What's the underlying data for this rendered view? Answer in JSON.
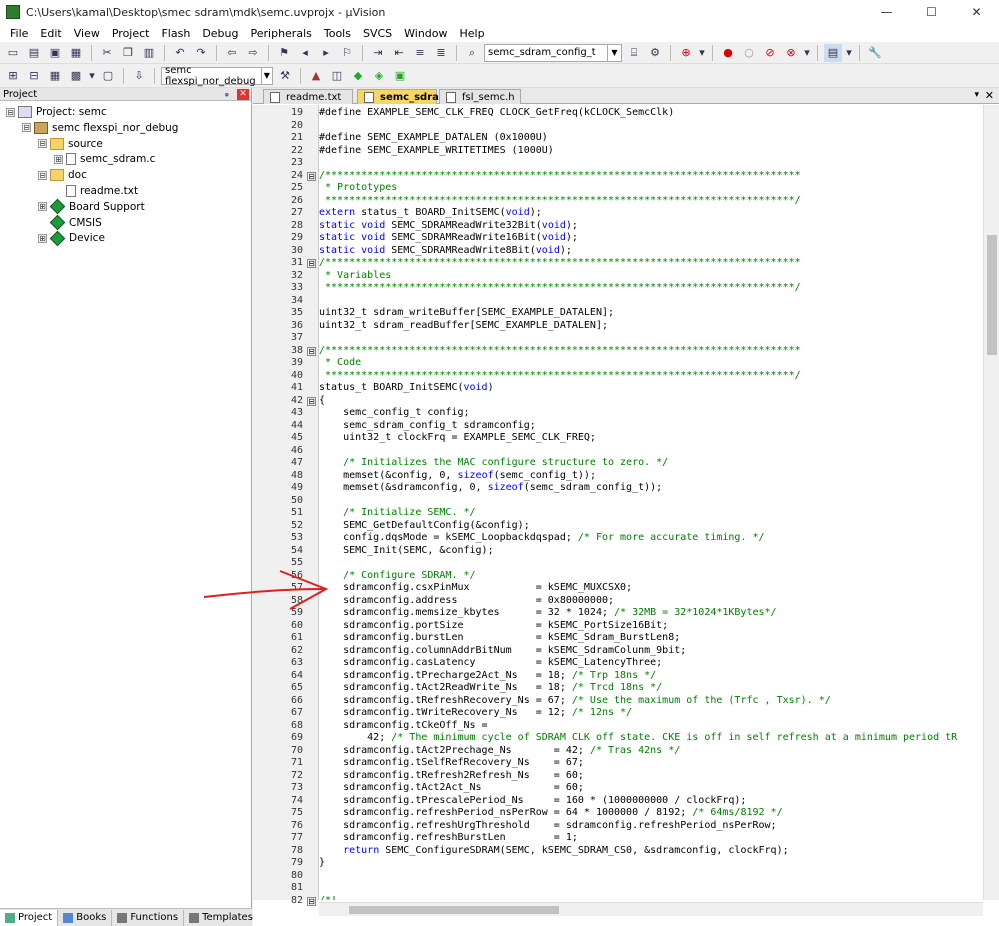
{
  "window": {
    "title": "C:\\Users\\kamal\\Desktop\\smec sdram\\mdk\\semc.uvprojx - µVision",
    "minimize": "—",
    "maximize": "☐",
    "close": "✕"
  },
  "menu": [
    "File",
    "Edit",
    "View",
    "Project",
    "Flash",
    "Debug",
    "Peripherals",
    "Tools",
    "SVCS",
    "Window",
    "Help"
  ],
  "toolbar": {
    "find_combo": "semc_sdram_config_t",
    "target_combo": "semc flexspi_nor_debug"
  },
  "project_panel": {
    "title": "Project",
    "pin": "ᵩ",
    "close": "✕",
    "tree": [
      {
        "level": 0,
        "exp": "⊟",
        "icon": "proj",
        "label": "Project: semc"
      },
      {
        "level": 1,
        "exp": "⊟",
        "icon": "target",
        "label": "semc flexspi_nor_debug"
      },
      {
        "level": 2,
        "exp": "⊟",
        "icon": "folder",
        "label": "source"
      },
      {
        "level": 3,
        "exp": "⊞",
        "icon": "file",
        "label": "semc_sdram.c"
      },
      {
        "level": 2,
        "exp": "⊟",
        "icon": "folder",
        "label": "doc"
      },
      {
        "level": 3,
        "exp": "",
        "icon": "file",
        "label": "readme.txt"
      },
      {
        "level": 2,
        "exp": "⊞",
        "icon": "gem",
        "label": "Board Support"
      },
      {
        "level": 2,
        "exp": "",
        "icon": "gem",
        "label": "CMSIS"
      },
      {
        "level": 2,
        "exp": "⊞",
        "icon": "gem",
        "label": "Device"
      }
    ],
    "bottom_tabs": [
      "Project",
      "Books",
      "Functions",
      "Templates"
    ]
  },
  "editor": {
    "tabs": [
      {
        "label": "readme.txt",
        "active": false
      },
      {
        "label": "semc_sdram.c",
        "active": true
      },
      {
        "label": "fsl_semc.h",
        "active": false
      }
    ],
    "tab_dropdown": "▾",
    "tab_close": "✕",
    "lines": [
      {
        "n": "19",
        "fold": "",
        "text": "#define EXAMPLE_SEMC_CLK_FREQ CLOCK_GetFreq(kCLOCK_SemcClk)"
      },
      {
        "n": "20",
        "fold": "",
        "text": ""
      },
      {
        "n": "21",
        "fold": "",
        "text": "#define SEMC_EXAMPLE_DATALEN (0x1000U)"
      },
      {
        "n": "22",
        "fold": "",
        "text": "#define SEMC_EXAMPLE_WRITETIMES (1000U)"
      },
      {
        "n": "23",
        "fold": "",
        "text": ""
      },
      {
        "n": "24",
        "fold": "⊟",
        "text": "/*******************************************************************************"
      },
      {
        "n": "25",
        "fold": "",
        "text": " * Prototypes"
      },
      {
        "n": "26",
        "fold": "",
        "text": " ******************************************************************************/"
      },
      {
        "n": "27",
        "fold": "",
        "text": "extern status_t BOARD_InitSEMC(void);"
      },
      {
        "n": "28",
        "fold": "",
        "text": "static void SEMC_SDRAMReadWrite32Bit(void);"
      },
      {
        "n": "29",
        "fold": "",
        "text": "static void SEMC_SDRAMReadWrite16Bit(void);"
      },
      {
        "n": "30",
        "fold": "",
        "text": "static void SEMC_SDRAMReadWrite8Bit(void);"
      },
      {
        "n": "31",
        "fold": "⊟",
        "text": "/*******************************************************************************"
      },
      {
        "n": "32",
        "fold": "",
        "text": " * Variables"
      },
      {
        "n": "33",
        "fold": "",
        "text": " ******************************************************************************/"
      },
      {
        "n": "34",
        "fold": "",
        "text": ""
      },
      {
        "n": "35",
        "fold": "",
        "text": "uint32_t sdram_writeBuffer[SEMC_EXAMPLE_DATALEN];"
      },
      {
        "n": "36",
        "fold": "",
        "text": "uint32_t sdram_readBuffer[SEMC_EXAMPLE_DATALEN];"
      },
      {
        "n": "37",
        "fold": "",
        "text": ""
      },
      {
        "n": "38",
        "fold": "⊟",
        "text": "/*******************************************************************************"
      },
      {
        "n": "39",
        "fold": "",
        "text": " * Code"
      },
      {
        "n": "40",
        "fold": "",
        "text": " ******************************************************************************/"
      },
      {
        "n": "41",
        "fold": "",
        "text": "status_t BOARD_InitSEMC(void)"
      },
      {
        "n": "42",
        "fold": "⊟",
        "text": "{"
      },
      {
        "n": "43",
        "fold": "",
        "text": "    semc_config_t config;"
      },
      {
        "n": "44",
        "fold": "",
        "text": "    semc_sdram_config_t sdramconfig;"
      },
      {
        "n": "45",
        "fold": "",
        "text": "    uint32_t clockFrq = EXAMPLE_SEMC_CLK_FREQ;"
      },
      {
        "n": "46",
        "fold": "",
        "text": ""
      },
      {
        "n": "47",
        "fold": "",
        "text": "    /* Initializes the MAC configure structure to zero. */"
      },
      {
        "n": "48",
        "fold": "",
        "text": "    memset(&config, 0, sizeof(semc_config_t));"
      },
      {
        "n": "49",
        "fold": "",
        "text": "    memset(&sdramconfig, 0, sizeof(semc_sdram_config_t));"
      },
      {
        "n": "50",
        "fold": "",
        "text": ""
      },
      {
        "n": "51",
        "fold": "",
        "text": "    /* Initialize SEMC. */"
      },
      {
        "n": "52",
        "fold": "",
        "text": "    SEMC_GetDefaultConfig(&config);"
      },
      {
        "n": "53",
        "fold": "",
        "text": "    config.dqsMode = kSEMC_Loopbackdqspad; /* For more accurate timing. */"
      },
      {
        "n": "54",
        "fold": "",
        "text": "    SEMC_Init(SEMC, &config);"
      },
      {
        "n": "55",
        "fold": "",
        "text": ""
      },
      {
        "n": "56",
        "fold": "",
        "text": "    /* Configure SDRAM. */"
      },
      {
        "n": "57",
        "fold": "",
        "text": "    sdramconfig.csxPinMux           = kSEMC_MUXCSX0;"
      },
      {
        "n": "58",
        "fold": "",
        "text": "    sdramconfig.address             = 0x80000000;"
      },
      {
        "n": "59",
        "fold": "",
        "text": "    sdramconfig.memsize_kbytes      = 32 * 1024; /* 32MB = 32*1024*1KBytes*/"
      },
      {
        "n": "60",
        "fold": "",
        "text": "    sdramconfig.portSize            = kSEMC_PortSize16Bit;"
      },
      {
        "n": "61",
        "fold": "",
        "text": "    sdramconfig.burstLen            = kSEMC_Sdram_BurstLen8;"
      },
      {
        "n": "62",
        "fold": "",
        "text": "    sdramconfig.columnAddrBitNum    = kSEMC_SdramColunm_9bit;"
      },
      {
        "n": "63",
        "fold": "",
        "text": "    sdramconfig.casLatency          = kSEMC_LatencyThree;"
      },
      {
        "n": "64",
        "fold": "",
        "text": "    sdramconfig.tPrecharge2Act_Ns   = 18; /* Trp 18ns */"
      },
      {
        "n": "65",
        "fold": "",
        "text": "    sdramconfig.tAct2ReadWrite_Ns   = 18; /* Trcd 18ns */"
      },
      {
        "n": "66",
        "fold": "",
        "text": "    sdramconfig.tRefreshRecovery_Ns = 67; /* Use the maximum of the (Trfc , Txsr). */"
      },
      {
        "n": "67",
        "fold": "",
        "text": "    sdramconfig.tWriteRecovery_Ns   = 12; /* 12ns */"
      },
      {
        "n": "68",
        "fold": "",
        "text": "    sdramconfig.tCkeOff_Ns ="
      },
      {
        "n": "69",
        "fold": "",
        "text": "        42; /* The minimum cycle of SDRAM CLK off state. CKE is off in self refresh at a minimum period tR"
      },
      {
        "n": "70",
        "fold": "",
        "text": "    sdramconfig.tAct2Prechage_Ns       = 42; /* Tras 42ns */"
      },
      {
        "n": "71",
        "fold": "",
        "text": "    sdramconfig.tSelfRefRecovery_Ns    = 67;"
      },
      {
        "n": "72",
        "fold": "",
        "text": "    sdramconfig.tRefresh2Refresh_Ns    = 60;"
      },
      {
        "n": "73",
        "fold": "",
        "text": "    sdramconfig.tAct2Act_Ns            = 60;"
      },
      {
        "n": "74",
        "fold": "",
        "text": "    sdramconfig.tPrescalePeriod_Ns     = 160 * (1000000000 / clockFrq);"
      },
      {
        "n": "75",
        "fold": "",
        "text": "    sdramconfig.refreshPeriod_nsPerRow = 64 * 1000000 / 8192; /* 64ms/8192 */"
      },
      {
        "n": "76",
        "fold": "",
        "text": "    sdramconfig.refreshUrgThreshold    = sdramconfig.refreshPeriod_nsPerRow;"
      },
      {
        "n": "77",
        "fold": "",
        "text": "    sdramconfig.refreshBurstLen        = 1;"
      },
      {
        "n": "78",
        "fold": "",
        "text": "    return SEMC_ConfigureSDRAM(SEMC, kSEMC_SDRAM_CS0, &sdramconfig, clockFrq);"
      },
      {
        "n": "79",
        "fold": "",
        "text": "}"
      },
      {
        "n": "80",
        "fold": "",
        "text": ""
      },
      {
        "n": "81",
        "fold": "",
        "text": ""
      },
      {
        "n": "82",
        "fold": "⊟",
        "text": "/*!"
      }
    ]
  },
  "colors": {
    "keyword": "#0000ff",
    "comment": "#008000",
    "number": "#808080",
    "define": "#000080",
    "annotation_arrow": "#e02020"
  }
}
